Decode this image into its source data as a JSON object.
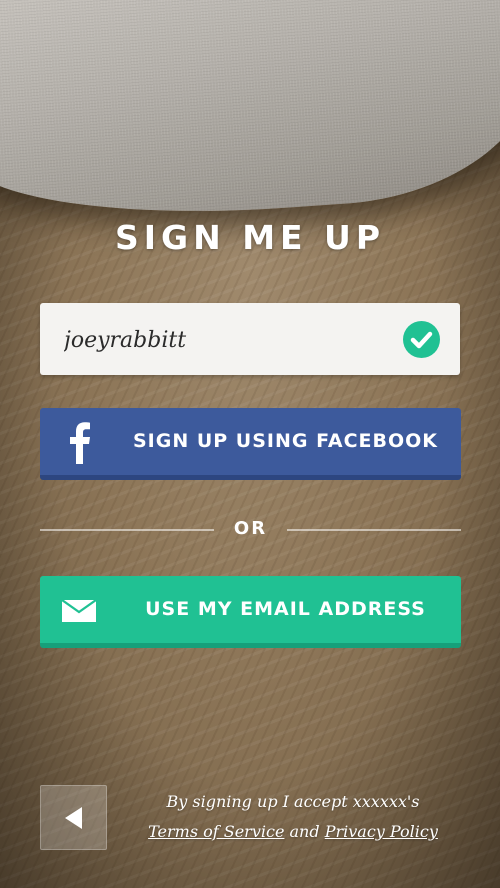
{
  "title": "SIGN ME UP",
  "username": {
    "value": "joeyrabbitt",
    "valid": true,
    "valid_color": "#20C193"
  },
  "facebook_button": {
    "label": "SIGN UP USING FACEBOOK",
    "icon": "facebook-f-icon",
    "color": "#3D5A9C"
  },
  "divider": {
    "label": "OR"
  },
  "email_button": {
    "label": "USE MY EMAIL ADDRESS",
    "icon": "envelope-icon",
    "color": "#20C193"
  },
  "back_button": {
    "icon": "triangle-left-icon"
  },
  "terms": {
    "line1": "By signing up I accept xxxxxx's",
    "terms_link": "Terms of Service",
    "conjunction": "and",
    "privacy_link": "Privacy Policy"
  }
}
